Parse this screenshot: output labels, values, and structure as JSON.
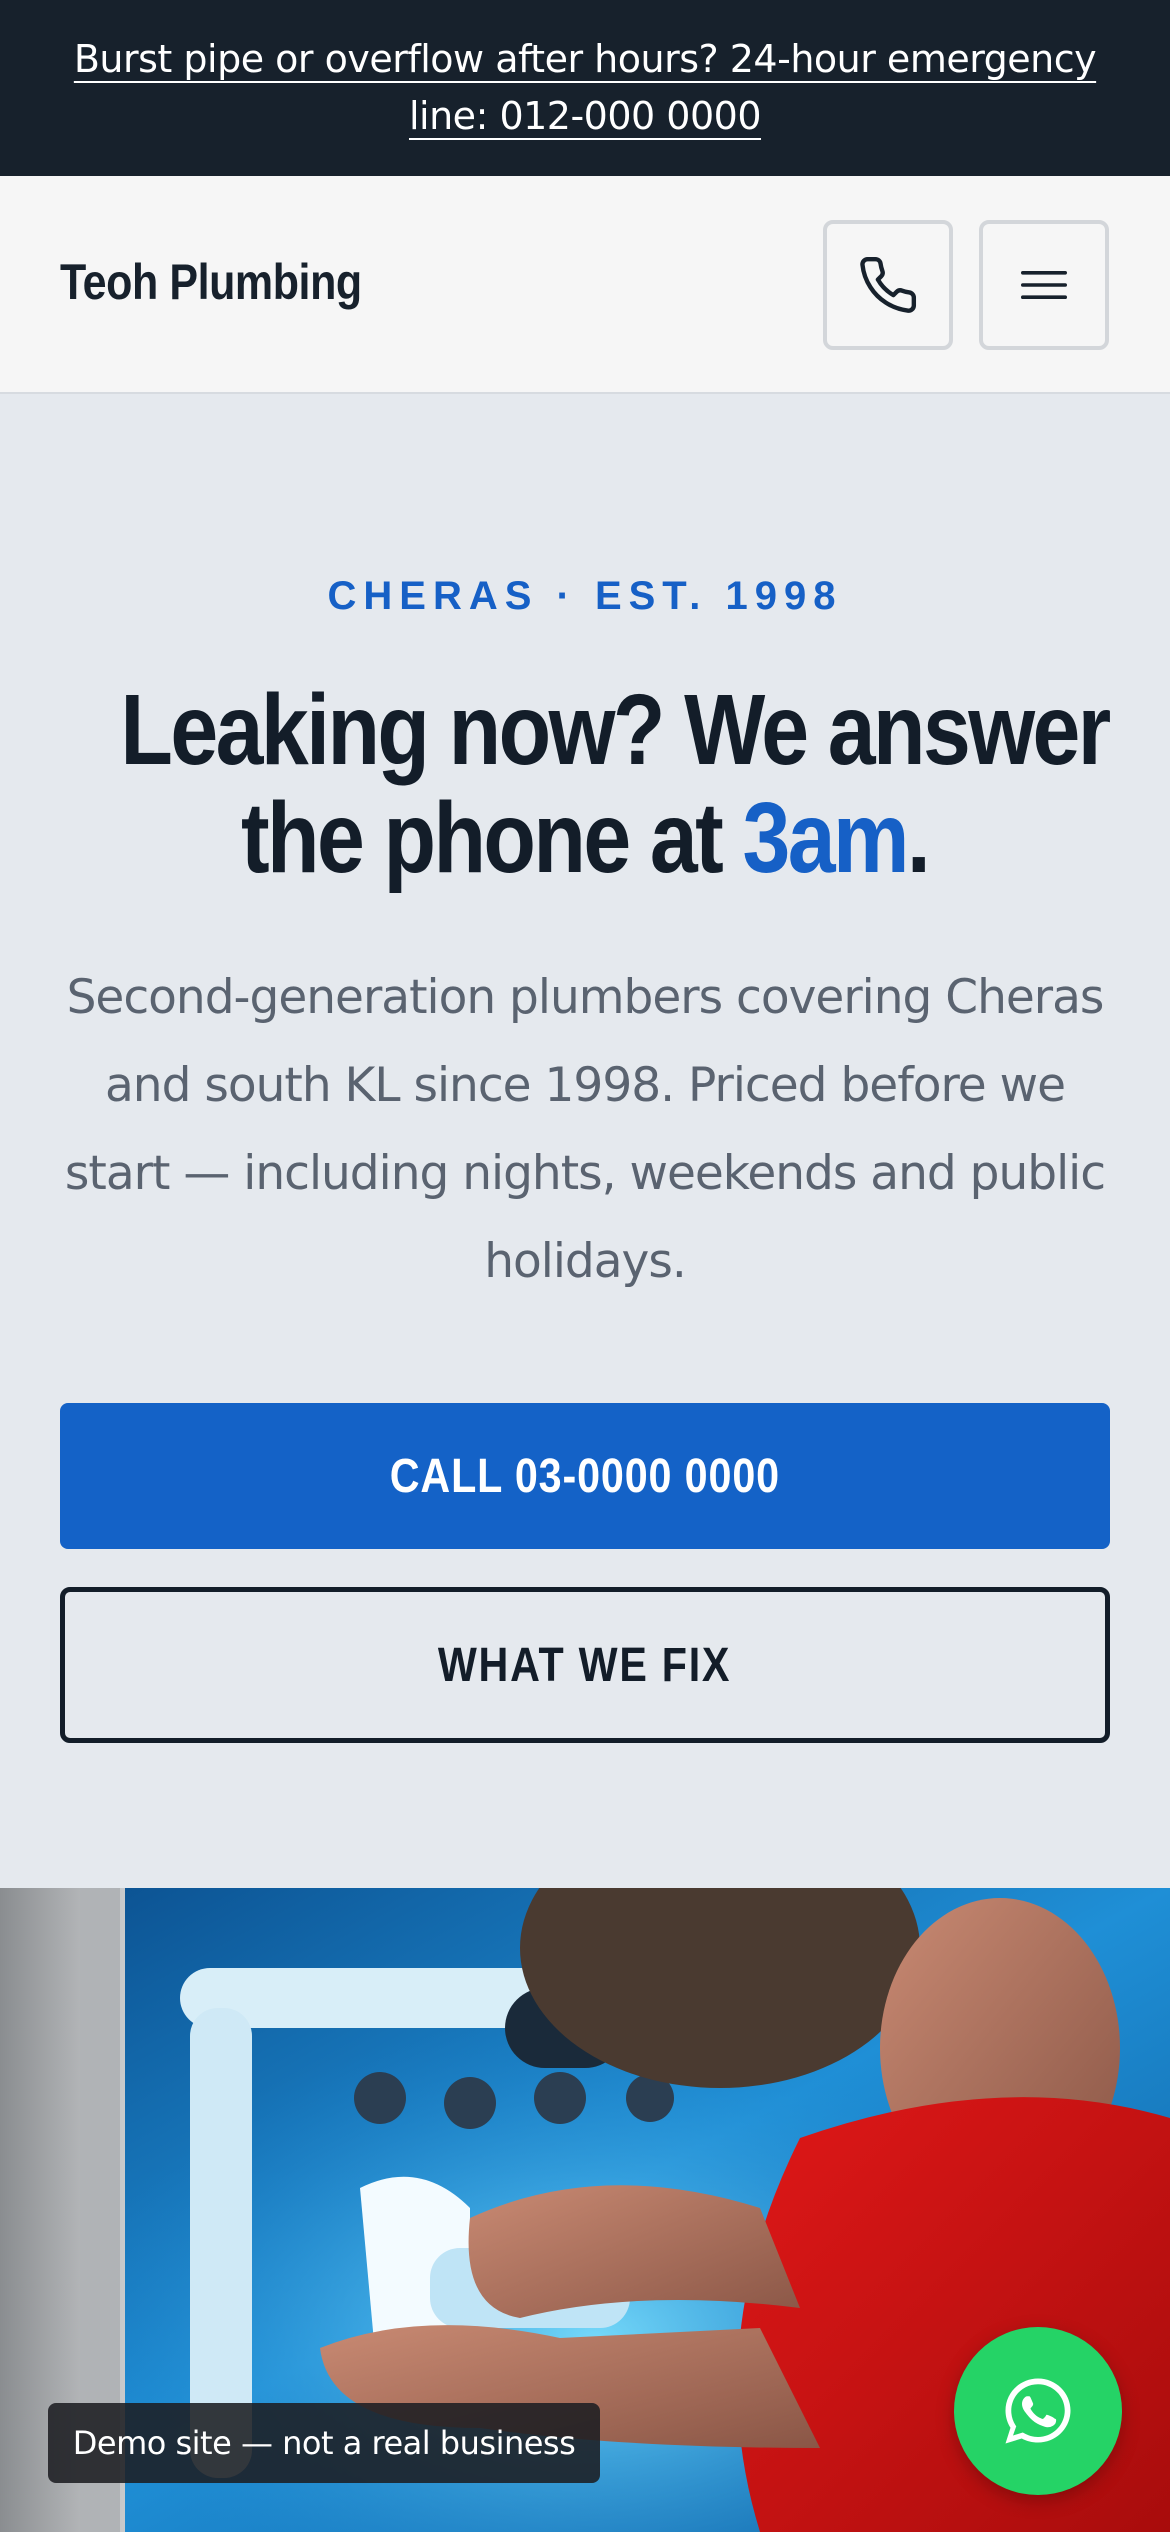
{
  "emergency_bar": {
    "text": "Burst pipe or overflow after hours? 24-hour emergency line: 012-000 0000"
  },
  "header": {
    "brand": "Teoh Plumbing",
    "phone_icon": "phone-icon",
    "menu_icon": "hamburger-menu-icon"
  },
  "hero": {
    "eyebrow": "CHERAS · EST. 1998",
    "headline_line1": "Leaking now? We answer",
    "headline_line2_prefix": "the phone at ",
    "headline_accent": "3am",
    "headline_suffix": ".",
    "lede": "Second-generation plumbers covering Cheras and south KL since 1998. Priced before we start — including nights, weekends and public holidays.",
    "primary_cta": "CALL 03-0000 0000",
    "secondary_cta": "WHAT WE FIX"
  },
  "photo": {
    "subject": "plumber-fixing-sink-pipe-photo"
  },
  "demo_badge": "Demo site — not a real business",
  "whatsapp": {
    "icon": "whatsapp-icon"
  },
  "colors": {
    "accent": "#1660c6",
    "dark": "#17212c",
    "hero_bg": "#e5e9ee",
    "whatsapp": "#25d366"
  }
}
